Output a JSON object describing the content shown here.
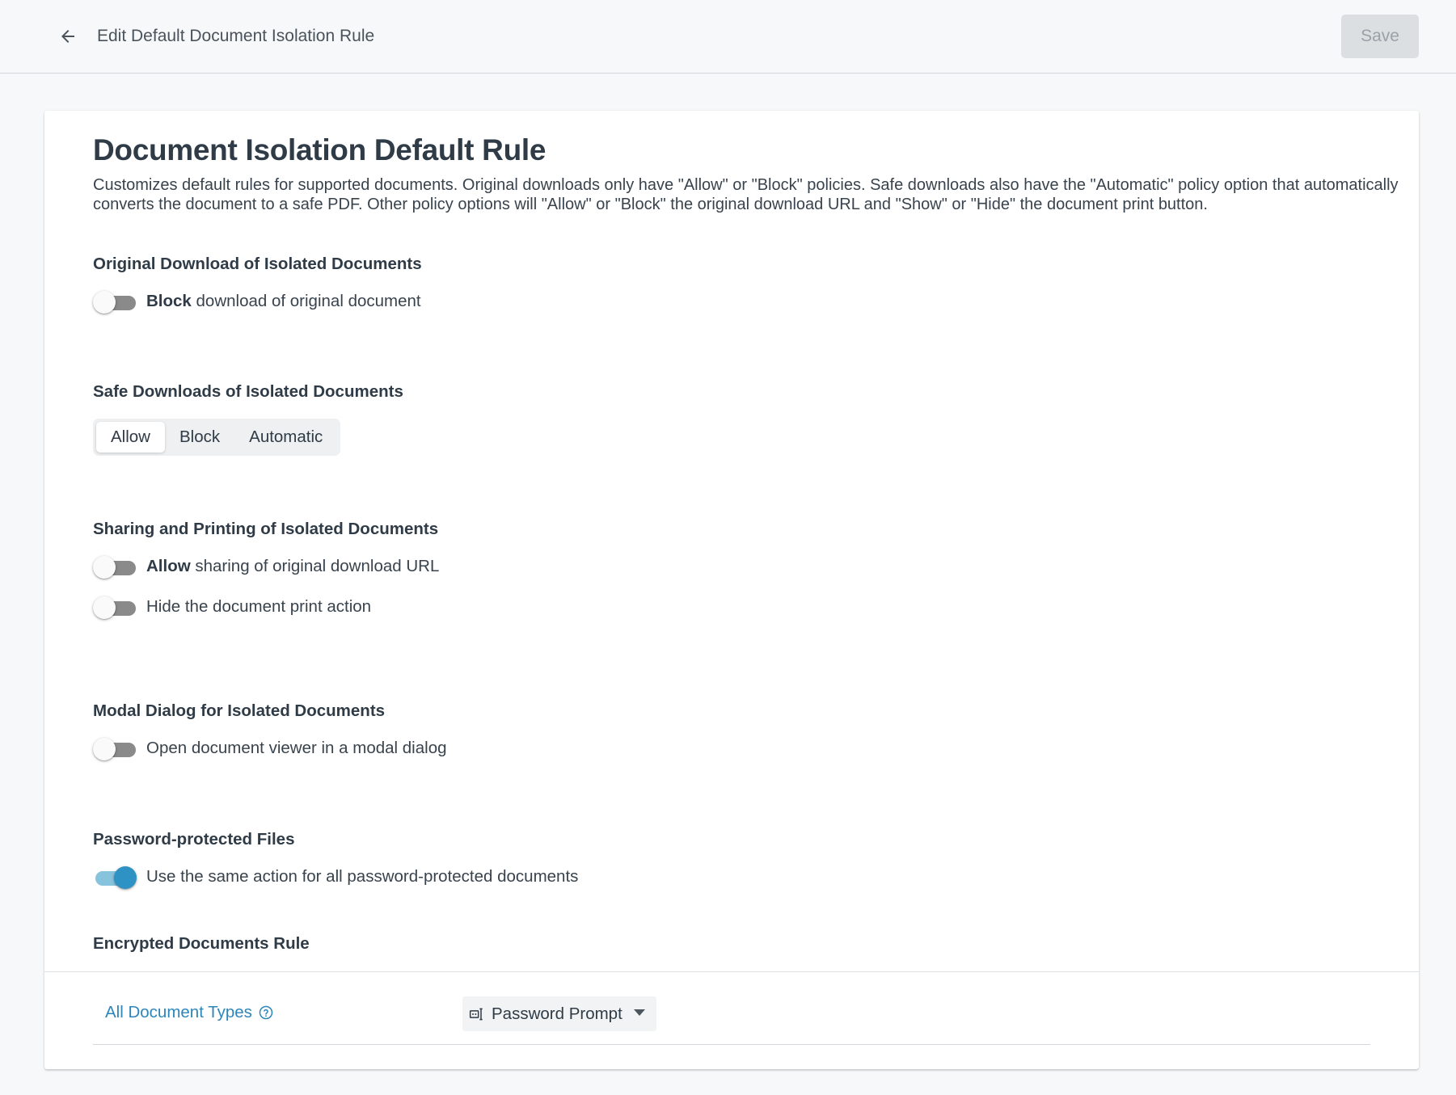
{
  "topbar": {
    "title": "Edit Default Document Isolation Rule",
    "back_icon": "arrow-left-icon",
    "save_label": "Save"
  },
  "page": {
    "title": "Document Isolation Default Rule",
    "description": "Customizes default rules for supported documents. Original downloads only have \"Allow\" or \"Block\" policies. Safe downloads also have the \"Automatic\" policy option that automatically converts the document to a safe PDF. Other policy options will \"Allow\" or \"Block\" the original download URL and \"Show\" or \"Hide\" the document print button."
  },
  "original_download": {
    "title": "Original Download of Isolated Documents",
    "toggle_bold": "Block",
    "toggle_text": " download of original document",
    "toggle_on": false
  },
  "safe_downloads": {
    "title": "Safe Downloads of Isolated Documents",
    "options": [
      "Allow",
      "Block",
      "Automatic"
    ],
    "selected": "Allow"
  },
  "sharing_printing": {
    "title": "Sharing and Printing of Isolated Documents",
    "share_bold": "Allow",
    "share_text": " sharing of original download URL",
    "share_on": false,
    "print_text": "Hide the document print action",
    "print_on": false
  },
  "modal_dialog": {
    "title": "Modal Dialog for Isolated Documents",
    "toggle_text": "Open document viewer in a modal dialog",
    "toggle_on": false
  },
  "password_files": {
    "title": "Password-protected Files",
    "toggle_text": "Use the same action for all password-protected documents",
    "toggle_on": true
  },
  "encrypted_rule": {
    "title": "Encrypted Documents Rule",
    "doc_types_label": "All Document Types",
    "help_icon": "help-circle-icon",
    "action_icon": "password-input-icon",
    "action_value": "Password Prompt"
  },
  "colors": {
    "accent": "#2e93c4",
    "link": "#2d86b9",
    "text": "#2f3b46"
  }
}
